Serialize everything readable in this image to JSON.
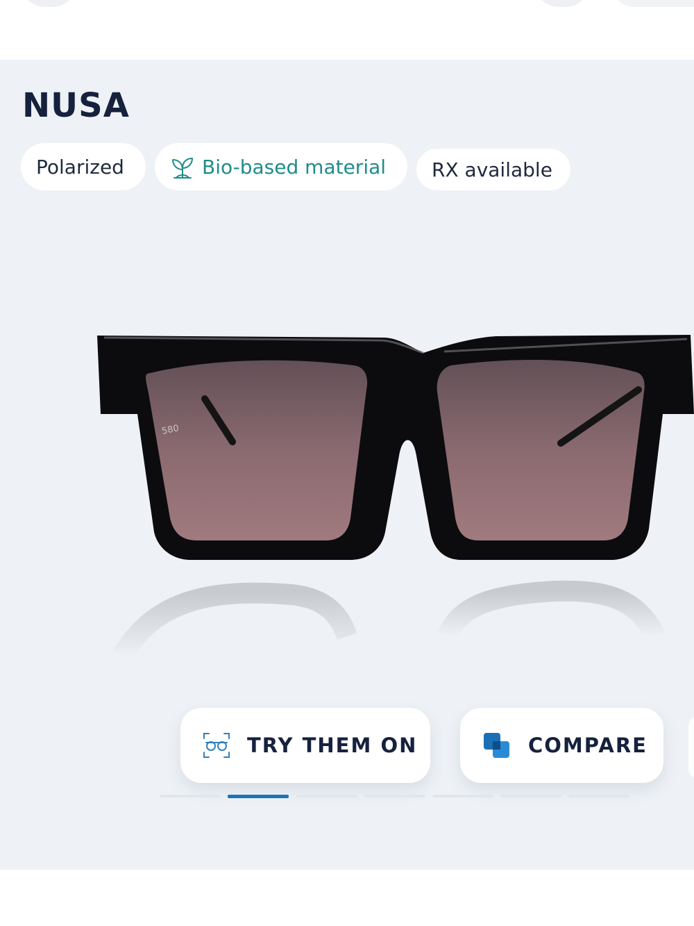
{
  "product": {
    "name": "NUSA",
    "features": [
      "Polarized",
      "Bio-based material",
      "RX available"
    ],
    "image_alt": "NUSA sunglasses, black frame with rose gradient lenses",
    "temple_logo": "580"
  },
  "actions": {
    "try_on_label": "TRY THEM ON",
    "compare_label": "COMPARE"
  },
  "gallery": {
    "total_slides": 7,
    "active_slide": 2
  },
  "colors": {
    "title": "#16213e",
    "accent_teal": "#1e8c8a",
    "accent_blue": "#1b73b3",
    "panel_background": "#eef2f6"
  },
  "icons": {
    "bio": "leaf-icon",
    "try_on": "face-glasses-icon",
    "compare": "compare-squares-icon"
  }
}
